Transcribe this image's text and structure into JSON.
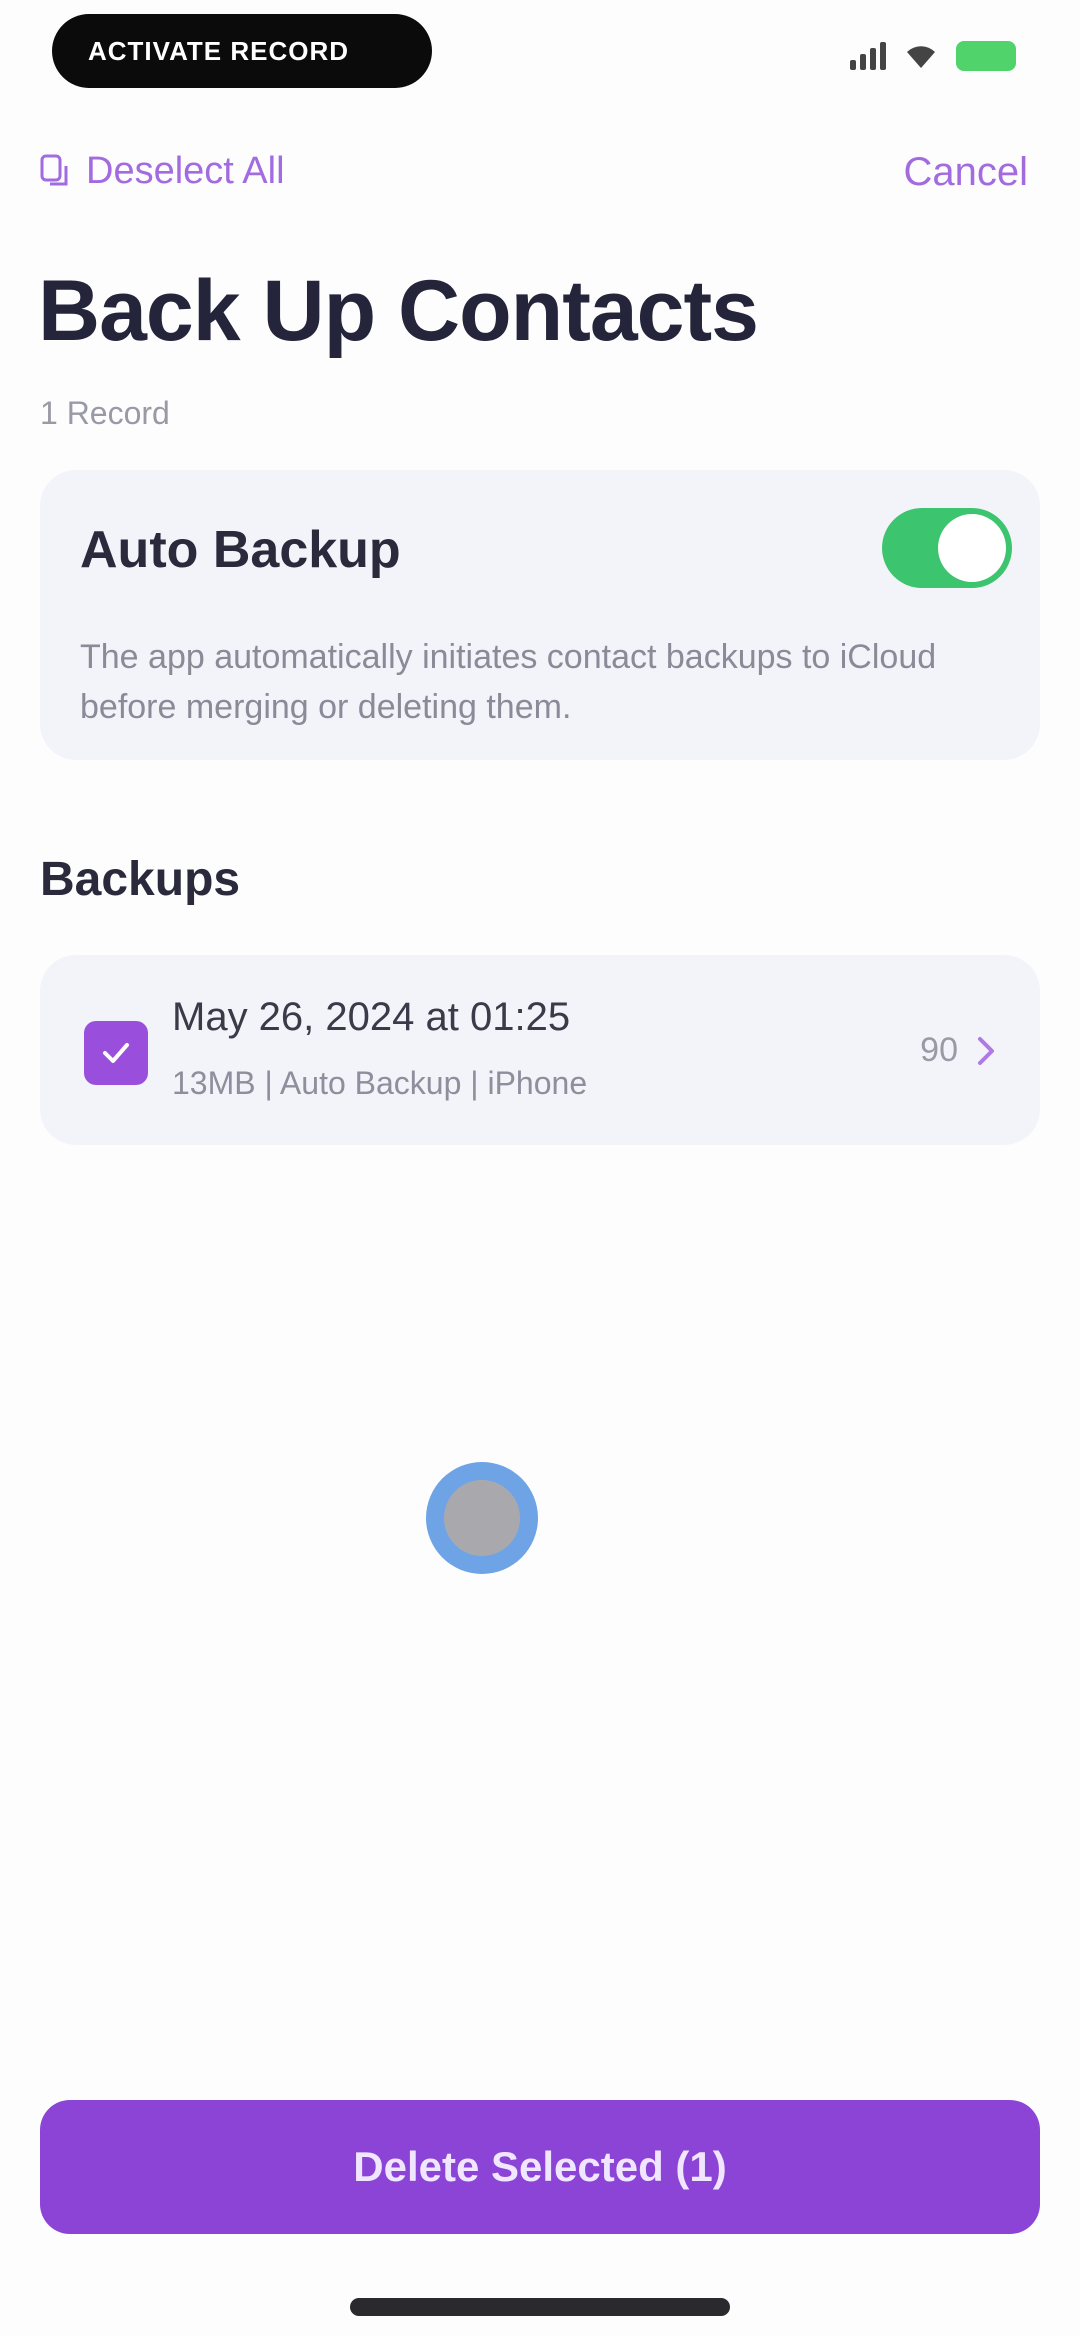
{
  "status_bar": {
    "pill_text": "ACTIVATE RECORD"
  },
  "nav": {
    "deselect_label": "Deselect All",
    "cancel_label": "Cancel"
  },
  "page": {
    "title": "Back Up Contacts",
    "subtitle": "1 Record"
  },
  "auto_backup": {
    "title": "Auto Backup",
    "enabled": true,
    "description": "The app automatically initiates contact backups to iCloud before merging or deleting them."
  },
  "backups": {
    "section_title": "Backups",
    "items": [
      {
        "title": "May 26, 2024 at 01:25",
        "subtitle": "13MB | Auto Backup | iPhone",
        "count": "90",
        "selected": true
      }
    ]
  },
  "footer": {
    "delete_label": "Delete Selected (1)"
  },
  "colors": {
    "accent": "#8c44d6",
    "toggle_on": "#3cc46e",
    "card_bg": "#f3f3fa"
  }
}
